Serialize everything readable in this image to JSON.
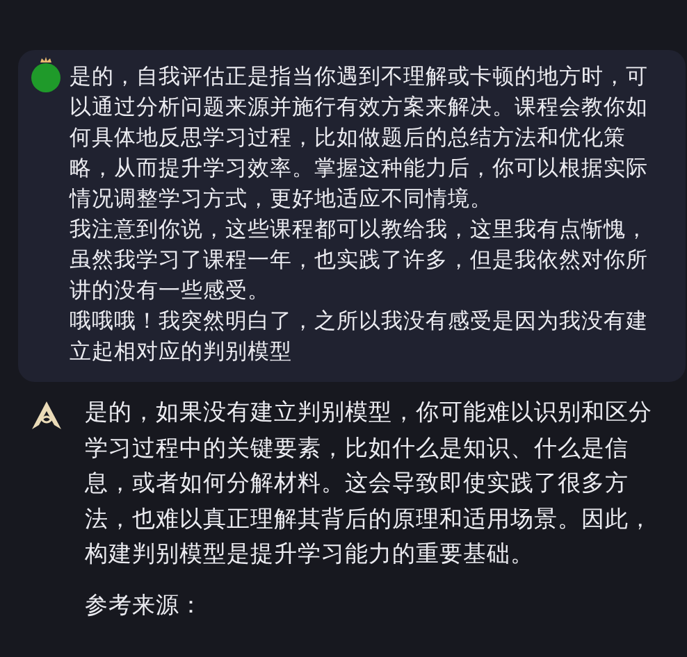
{
  "user_message": {
    "paragraphs": [
      "是的，自我评估正是指当你遇到不理解或卡顿的地方时，可以通过分析问题来源并施行有效方案来解决。课程会教你如何具体地反思学习过程，比如做题后的总结方法和优化策略，从而提升学习效率。掌握这种能力后，你可以根据实际情况调整学习方式，更好地适应不同情境。",
      "我注意到你说，这些课程都可以教给我，这里我有点惭愧，虽然我学习了课程一年，也实践了许多，但是我依然对你所讲的没有一些感受。",
      "哦哦哦！我突然明白了，之所以我没有感受是因为我没有建立起相对应的判别模型"
    ]
  },
  "assistant_message": {
    "paragraphs": [
      "是的，如果没有建立判别模型，你可能难以识别和区分学习过程中的关键要素，比如什么是知识、什么是信息，或者如何分解材料。这会导致即使实践了很多方法，也难以真正理解其背后的原理和适用场景。因此，构建判别模型是提升学习能力的重要基础。"
    ],
    "sources_label": "参考来源："
  }
}
